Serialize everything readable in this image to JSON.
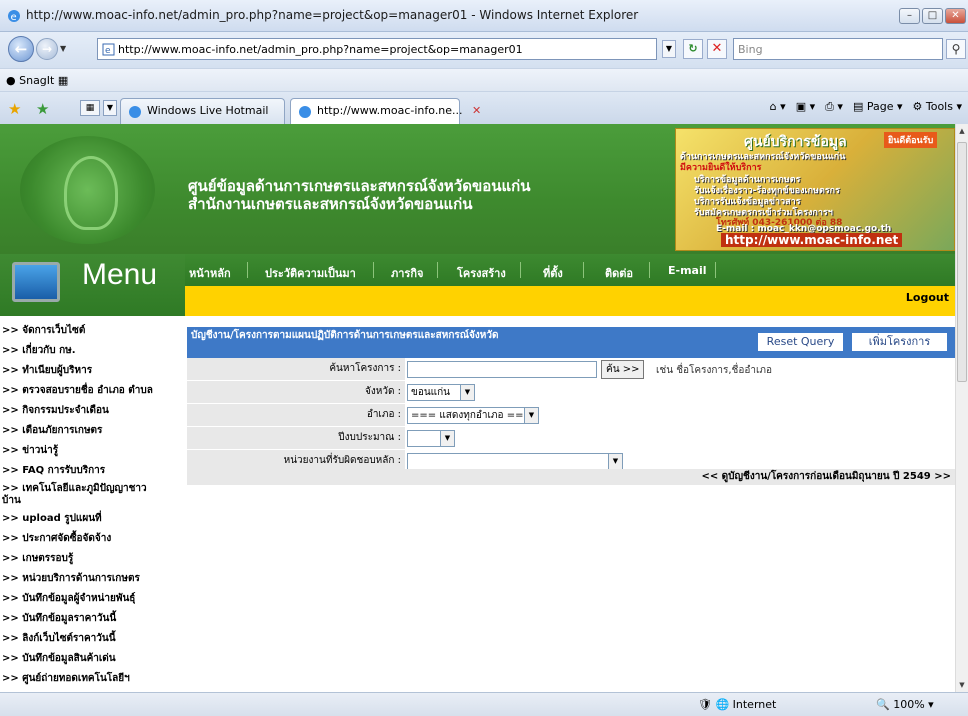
{
  "window": {
    "title": "http://www.moac-info.net/admin_pro.php?name=project&op=manager01 - Windows Internet Explorer"
  },
  "address_bar": {
    "url": "http://www.moac-info.net/admin_pro.php?name=project&op=manager01",
    "search_placeholder": "Bing"
  },
  "links_bar": {
    "snagit_label": "SnagIt"
  },
  "tabs": [
    {
      "label": "Windows Live Hotmail",
      "active": false
    },
    {
      "label": "http://www.moac-info.ne...",
      "active": true
    }
  ],
  "command_bar": {
    "page_label": "Page",
    "tools_label": "Tools"
  },
  "banner": {
    "title_line1": "ศูนย์ข้อมูลด้านการเกษตรและสหกรณ์จังหวัดขอนแก่น",
    "title_line2": "สำนักงานเกษตรและสหกรณ์จังหวัดขอนแก่น",
    "ad": {
      "heading": "ศูนย์บริการข้อมูล",
      "badge": "ยินดีต้อนรับ",
      "lines": [
        "ด้านการเกษตรและสหกรณ์จังหวัดขอนแก่น",
        "มีความยินดีให้บริการ",
        "บริการข้อมูลด้านการเกษตร",
        "รับแจ้งเรื่องราว-ร้องทุกข์ของเกษตรกร",
        "บริการรับแจ้งข้อมูลข่าวสาร",
        "รับสมัครเกษตรกรเข้าร่วมโครงการฯ",
        "โทรศัพท์ 043-261000 ต่อ 88",
        "E-mail : moac_kkn@opsmoac.go.th"
      ],
      "url": "http://www.moac-info.net"
    }
  },
  "sidebar": {
    "menu_title": "Menu",
    "items": [
      ">> จัดการเว็บไซต์",
      ">> เกี่ยวกับ กษ.",
      ">> ทำเนียบผู้บริหาร",
      ">> ตรวจสอบรายชื่อ อำเภอ ตำบล",
      ">> กิจกรรมประจำเดือน",
      ">> เตือนภัยการเกษตร",
      ">> ข่าวน่ารู้",
      ">> FAQ การรับบริการ",
      ">> เทคโนโลยีและภูมิปัญญาชาว",
      "บ้าน",
      ">> upload รูปแผนที่",
      ">> ประกาศจัดซื้อจัดจ้าง",
      ">> เกษตรรอบรู้",
      ">> หน่วยบริการด้านการเกษตร",
      ">> บันทึกข้อมูลผู้จำหน่ายพันธุ์",
      ">> บันทึกข้อมูลราคาวันนี้",
      ">> ลิงก์เว็บไซต์ราคาวันนี้",
      ">> บันทึกข้อมูลสินค้าเด่น",
      ">> ศูนย์ถ่ายทอดเทคโนโลยีฯ"
    ]
  },
  "top_nav": {
    "items": [
      "หน้าหลัก",
      "ประวัติความเป็นมา",
      "ภารกิจ",
      "โครงสร้าง",
      "ที่ตั้ง",
      "ติดต่อ",
      "E-mail"
    ],
    "logout": "Logout"
  },
  "main": {
    "header_title": "บัญชีงาน/โครงการตามแผนปฏิบัติการด้านการเกษตรและสหกรณ์จังหวัด",
    "reset_button": "Reset Query",
    "add_button": "เพิ่มโครงการ",
    "form": {
      "search_label": "ค้นหาโครงการ :",
      "search_value": "",
      "search_button": "ค้น >>",
      "search_hint": "เช่น ชื่อโครงการ,ชื่ออำเภอ",
      "province_label": "จังหวัด :",
      "province_value": "ขอนแก่น",
      "district_label": "อำเภอ :",
      "district_value": "=== แสดงทุกอำเภอ ===",
      "budget_year_label": "ปีงบประมาณ :",
      "budget_year_value": "",
      "agency_label": "หน่วยงานที่รับผิดชอบหลัก :",
      "agency_value": ""
    },
    "old_list_link": "<< ดูบัญชีงาน/โครงการก่อนเดือนมิถุนายน ปี 2549 >>"
  },
  "status_bar": {
    "zone": "Internet",
    "zoom": "100%"
  }
}
